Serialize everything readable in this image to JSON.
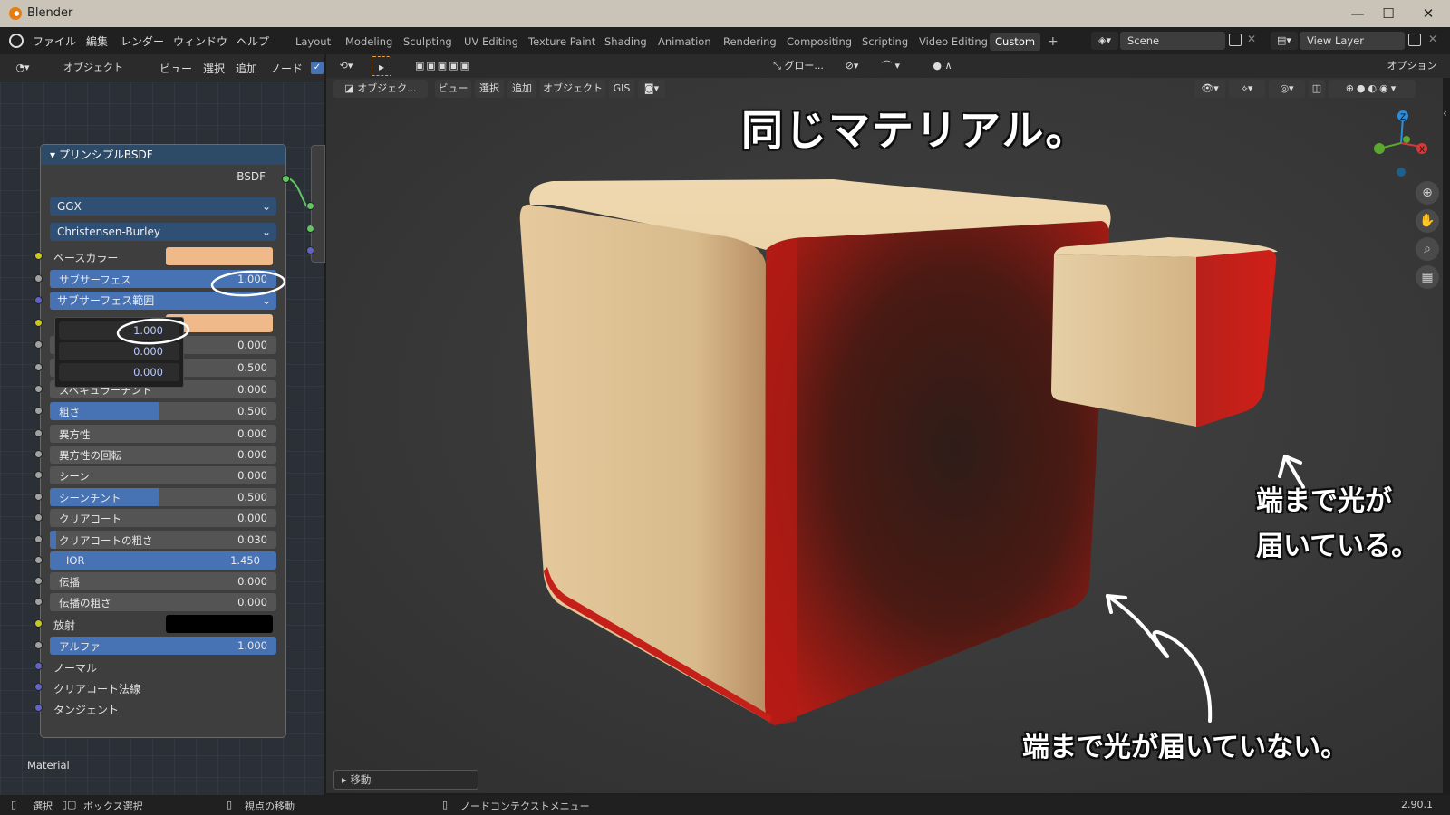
{
  "window": {
    "title": "Blender",
    "minimize": "—",
    "maximize": "☐",
    "close": "✕"
  },
  "menu": {
    "items": [
      "ファイル",
      "編集",
      "レンダー",
      "ウィンドウ",
      "ヘルプ"
    ]
  },
  "workspaces": {
    "tabs": [
      "Layout",
      "Modeling",
      "Sculpting",
      "UV Editing",
      "Texture Paint",
      "Shading",
      "Animation",
      "Rendering",
      "Compositing",
      "Scripting",
      "Video Editing",
      "Custom"
    ],
    "active": "Custom",
    "add": "+"
  },
  "scene": {
    "name": "Scene",
    "view_layer": "View Layer"
  },
  "node_editor": {
    "header": {
      "mode": "オブジェクト",
      "view": "ビュー",
      "select": "選択",
      "add": "追加",
      "node": "ノード"
    },
    "node_title": "プリンシプルBSDF",
    "output_label": "BSDF",
    "distribution": "GGX",
    "subsurface_method": "Christensen-Burley",
    "rows": [
      {
        "label": "ベースカラー",
        "type": "color",
        "color": "#f0b98a"
      },
      {
        "label": "サブサーフェス",
        "value": "1.000",
        "fill": 1.0
      },
      {
        "label": "サブサーフェス範囲",
        "type": "dropdown"
      },
      {
        "label": "",
        "type": "color",
        "color": "#f0b98a"
      },
      {
        "label": "",
        "value": "0.000",
        "fill": 0
      },
      {
        "label": "",
        "value": "0.500",
        "fill": 0
      },
      {
        "label": "スペキュラーチント",
        "value": "0.000",
        "fill": 0
      },
      {
        "label": "粗さ",
        "value": "0.500",
        "fill": 0.5
      },
      {
        "label": "異方性",
        "value": "0.000",
        "fill": 0
      },
      {
        "label": "異方性の回転",
        "value": "0.000",
        "fill": 0
      },
      {
        "label": "シーン",
        "value": "0.000",
        "fill": 0
      },
      {
        "label": "シーンチント",
        "value": "0.500",
        "fill": 0.5
      },
      {
        "label": "クリアコート",
        "value": "0.000",
        "fill": 0
      },
      {
        "label": "クリアコートの粗さ",
        "value": "0.030",
        "fill": 0.03
      },
      {
        "label": "IOR",
        "value": "1.450",
        "fill": 1.0
      },
      {
        "label": "伝播",
        "value": "0.000",
        "fill": 0
      },
      {
        "label": "伝播の粗さ",
        "value": "0.000",
        "fill": 0
      },
      {
        "label": "放射",
        "type": "color",
        "color": "#000000"
      },
      {
        "label": "アルファ",
        "value": "1.000",
        "fill": 1.0
      },
      {
        "label": "ノーマル",
        "type": "plain"
      },
      {
        "label": "クリアコート法線",
        "type": "plain"
      },
      {
        "label": "タンジェント",
        "type": "plain"
      }
    ],
    "popup_values": [
      "1.000",
      "0.000",
      "0.000"
    ],
    "material_label": "Material"
  },
  "viewport": {
    "header": {
      "orientation": "グロー...",
      "options": "オプション"
    },
    "header2": {
      "mode": "オブジェク...",
      "view": "ビュー",
      "select": "選択",
      "add": "追加",
      "object": "オブジェクト",
      "gis": "GIS"
    },
    "annotations": {
      "title": "同じマテリアル。",
      "right": [
        "端まで光が",
        "届いている。"
      ],
      "bottom": "端まで光が届いていない。"
    },
    "operator_panel": "移動"
  },
  "statusbar": {
    "select": "選択",
    "box_select": "ボックス選択",
    "move_view": "視点の移動",
    "context": "ノードコンテクストメニュー",
    "version": "2.90.1"
  },
  "colors": {
    "accent": "#4772b3",
    "node_header": "#2d4a66",
    "cube_base": "#ecd4a8",
    "cube_red": "#c0201a"
  }
}
